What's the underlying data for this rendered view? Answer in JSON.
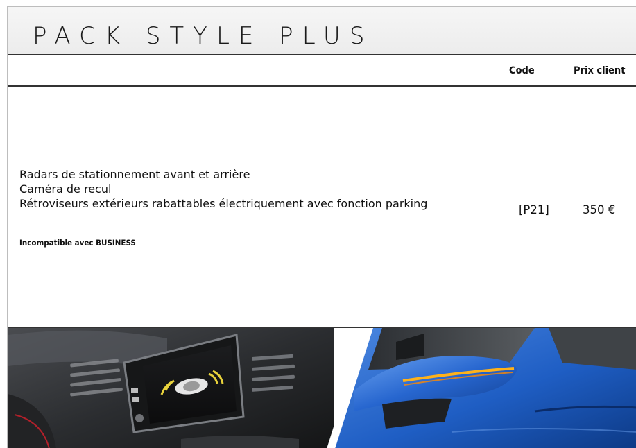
{
  "title": "PACK STYLE PLUS",
  "table": {
    "headers": {
      "code": "Code",
      "price": "Prix client"
    },
    "features": [
      "Radars de stationnement avant et arrière",
      "Caméra de recul",
      "Rétroviseurs extérieurs rabattables électriquement avec fonction parking"
    ],
    "note": "Incompatible avec BUSINESS",
    "code": "[P21]",
    "price": "350 €"
  },
  "photos": [
    {
      "name": "dashboard-parking-display-photo"
    },
    {
      "name": "blue-side-mirror-photo"
    }
  ]
}
